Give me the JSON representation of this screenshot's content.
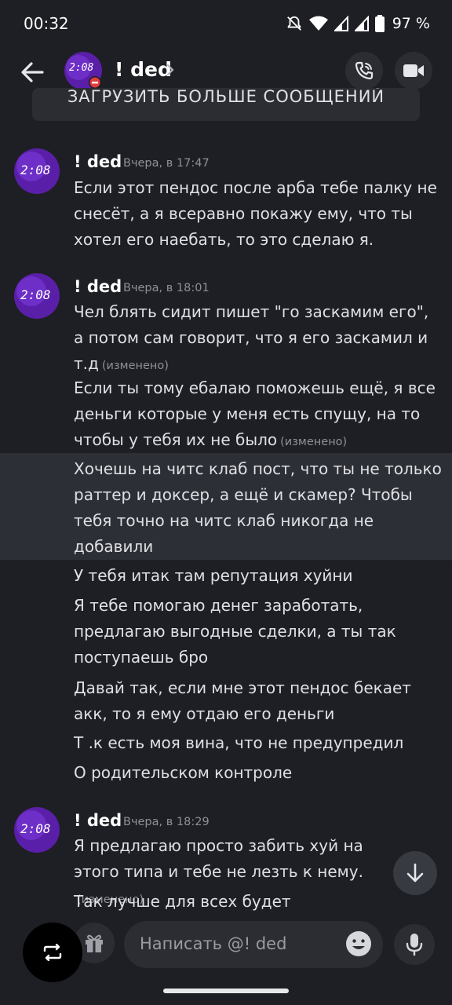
{
  "status_bar": {
    "time": "00:32",
    "battery": "97 %",
    "icons": [
      "do-not-disturb-icon",
      "wifi-icon",
      "cell-signal-icon",
      "cell-signal-icon",
      "battery-icon"
    ]
  },
  "header": {
    "title": "! ded",
    "avatar_text": "2:08",
    "icons": [
      "back-arrow-icon",
      "chevron-right-icon",
      "phone-call-icon",
      "video-call-icon"
    ]
  },
  "load_more": {
    "label": "ЗАГРУЗИТЬ БОЛЬШЕ СООБЩЕНИЙ"
  },
  "messages": [
    {
      "author": "! ded",
      "time": "Вчера, в 17:47",
      "avatar_text": "2:08",
      "lines": [
        "Если этот пендос после арба тебе палку не снесёт, а я всеравно покажу ему, что ты хотел его наебать, то это сделаю я."
      ]
    },
    {
      "author": "! ded",
      "time": "Вчера, в 18:01",
      "avatar_text": "2:08",
      "lines": [
        "Чел блять сидит пишет \"го заскамим его\", а потом сам говорит, что я его заскамил и т.д",
        "Если ты тому ебалаю поможешь ещё,  я все деньги которые у меня есть спущу, на то чтобы у тебя их не было",
        "Хочешь на читс клаб пост, что ты не только раттер и доксер, а ещё и скамер? Чтобы тебя точно на читс клаб никогда не добавили",
        "У тебя итак там репутация хуйни",
        "Я тебе помогаю денег заработать, предлагаю выгодные сделки, а ты так поступаешь бро",
        "Давай так, если мне этот пендос бекает акк, то я ему отдаю его деньги",
        "Т .к есть моя вина, что не предупредил",
        "О родительском контроле"
      ],
      "edited_label": "(изменено)"
    },
    {
      "author": "! ded",
      "time": "Вчера, в 18:29",
      "avatar_text": "2:08",
      "lines": [
        "Я предлагаю просто забить хуй на этого типа и тебе не лезть к нему.",
        "Так лучше для всех будет"
      ],
      "edited_label": "(изменено)"
    }
  ],
  "composer": {
    "placeholder": "Написать @! ded",
    "icons": [
      "swap-icon",
      "gift-icon",
      "emoji-icon",
      "microphone-icon",
      "arrow-down-icon"
    ]
  },
  "colors": {
    "background": "#1e1f24",
    "highlight": "#2d2f36",
    "text": "#dfe0e4",
    "muted": "#8e9098",
    "avatar_purple": "#5a1fa8",
    "dnd_red": "#e23c3c"
  }
}
